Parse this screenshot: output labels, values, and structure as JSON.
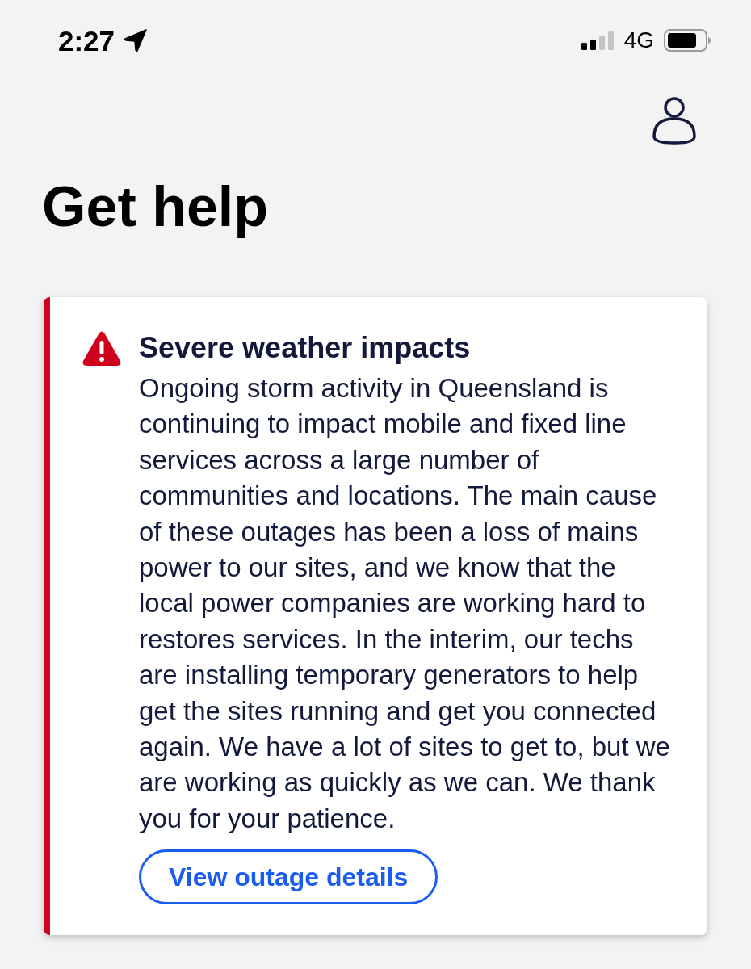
{
  "status_bar": {
    "time": "2:27",
    "network": "4G"
  },
  "header": {
    "title": "Get help"
  },
  "alert": {
    "title": "Severe weather impacts",
    "body": "Ongoing storm activity in Queensland is continuing to impact mobile and fixed line services across a large number of communities and locations. The main cause of these outages has been a loss of mains power to our sites, and we know that the local power companies are working hard to restores services. In the interim, our techs are installing temporary generators to help get the sites running and get you connected again. We have a lot of sites to get to, but we are working as quickly as we can. We thank you for your patience.",
    "button": "View outage details"
  }
}
